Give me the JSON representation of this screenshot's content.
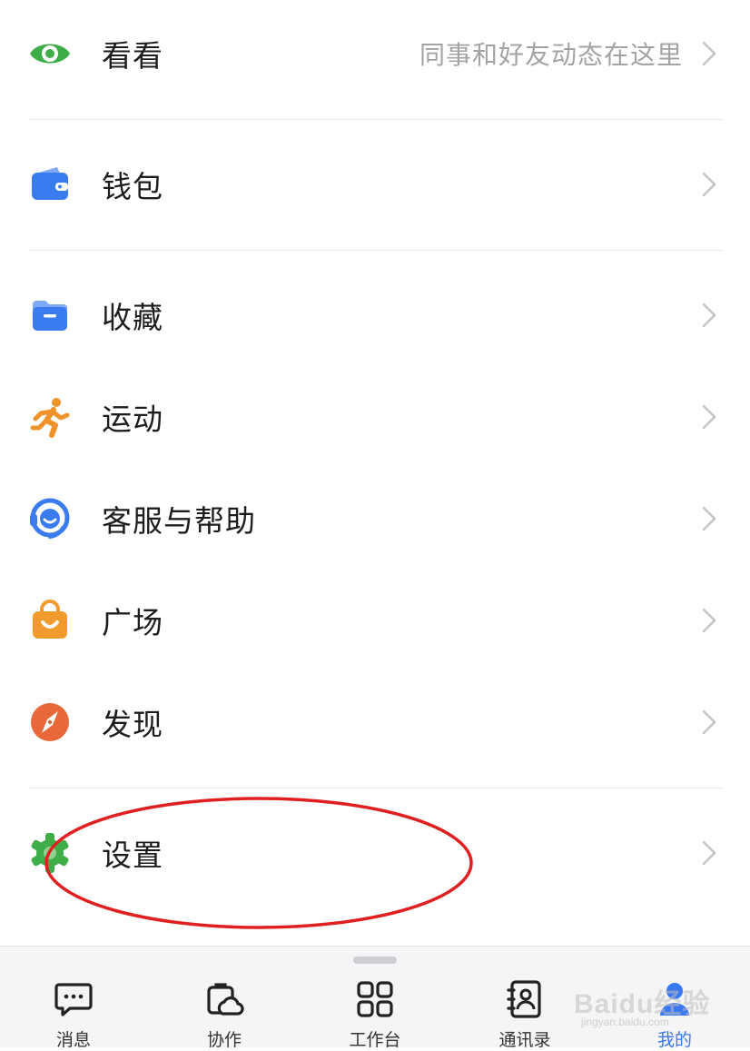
{
  "menu": [
    {
      "id": "kankan",
      "label": "看看",
      "hint": "同事和好友动态在这里",
      "icon": "eye-icon",
      "color": "#3fae49"
    },
    {
      "id": "wallet",
      "label": "钱包",
      "hint": "",
      "icon": "wallet-icon",
      "color": "#3a7bf0"
    },
    {
      "id": "favorites",
      "label": "收藏",
      "hint": "",
      "icon": "folder-icon",
      "color": "#3a7bf0"
    },
    {
      "id": "sports",
      "label": "运动",
      "hint": "",
      "icon": "running-person-icon",
      "color": "#f0932b"
    },
    {
      "id": "support",
      "label": "客服与帮助",
      "hint": "",
      "icon": "headset-icon",
      "color": "#3a7bf0"
    },
    {
      "id": "plaza",
      "label": "广场",
      "hint": "",
      "icon": "shopping-bag-icon",
      "color": "#f19a2d"
    },
    {
      "id": "discover",
      "label": "发现",
      "hint": "",
      "icon": "compass-icon",
      "color": "#e9683a"
    },
    {
      "id": "settings",
      "label": "设置",
      "hint": "",
      "icon": "gear-icon",
      "color": "#3fae49"
    }
  ],
  "tabbar": {
    "tabs": [
      {
        "label": "消息",
        "icon": "message-icon",
        "active": false
      },
      {
        "label": "协作",
        "icon": "collaboration-icon",
        "active": false
      },
      {
        "label": "工作台",
        "icon": "workbench-grid-icon",
        "active": false
      },
      {
        "label": "通讯录",
        "icon": "contacts-icon",
        "active": false
      },
      {
        "label": "我的",
        "icon": "profile-icon",
        "active": true
      }
    ]
  },
  "annotation": {
    "shape": "ellipse",
    "color": "#e02020",
    "target": "settings"
  },
  "watermark": {
    "text": "Baidu经验",
    "subtext": "jingyan.baidu.com"
  },
  "colors": {
    "accent": "#3a78f2",
    "text": "#1d1d1f",
    "hint": "#a3a3a3",
    "divider": "#e4e4e4"
  }
}
